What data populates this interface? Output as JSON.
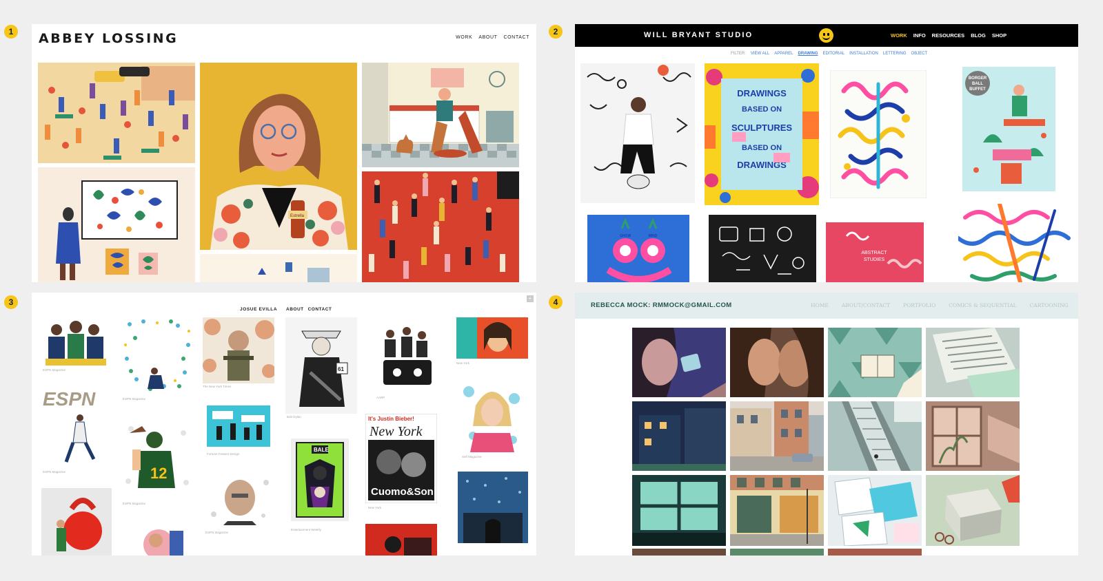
{
  "badges": [
    "1",
    "2",
    "3",
    "4"
  ],
  "panel1": {
    "brand": "ABBEY LOSSING",
    "nav": [
      "WORK",
      "ABOUT",
      "CONTACT"
    ],
    "bottle_label": "Estrella"
  },
  "panel2": {
    "brand": "WILL BRYANT STUDIO",
    "nav": [
      "WORK",
      "INFO",
      "RESOURCES",
      "BLOG",
      "SHOP"
    ],
    "filter": [
      "FILTER:",
      "VIEW ALL",
      "APPAREL",
      "DRAWING",
      "EDITORIAL",
      "INSTALLATION",
      "LETTERING",
      "OBJECT"
    ],
    "poster_text": [
      "DRAWINGS",
      "BASED ON",
      "SCULPTURES",
      "BASED ON",
      "DRAWINGS"
    ],
    "buffet_text": [
      "BORGER",
      "BALL",
      "BUFFET"
    ],
    "abstract_text": [
      "ABSTRACT",
      "STUDIES"
    ],
    "glasses_text": [
      "GHOW",
      "MIND"
    ]
  },
  "panel3": {
    "brand": "JOSUE EVILLA",
    "nav": [
      "ABOUT",
      "CONTACT"
    ],
    "captions": [
      "ESPN Magazine",
      "ESPN Magazine",
      "The New York Times",
      "Bob Dylan",
      "AARP",
      "New York",
      "ESPN Magazine",
      "Fortune Feature Design",
      "ESPN Magazine",
      "Entertainment Weekly",
      "New York",
      "Self Magazine",
      "ESPN Magazine"
    ],
    "espn_logo": "ESPN",
    "jersey_number": "12",
    "route_sign": "61",
    "bale_label": "BALE",
    "mag_headline": "It's Justin Bieber!",
    "mag_title": "New York",
    "mag_cover": "Cuomo&Son"
  },
  "panel4": {
    "brand": "REBECCA MOCK: RMMOCK@GMAIL.COM",
    "nav": [
      "HOME",
      "ABOUT/CONTACT",
      "PORTFOLIO",
      "COMICS & SEQUENTIAL",
      "CARTOONING"
    ]
  },
  "colors": {
    "badge": "#f5c518",
    "will_accent": "#f5c518",
    "filter_link": "#3a7bd5",
    "mock_brand": "#24544f",
    "mock_bar": "#e3eded"
  }
}
